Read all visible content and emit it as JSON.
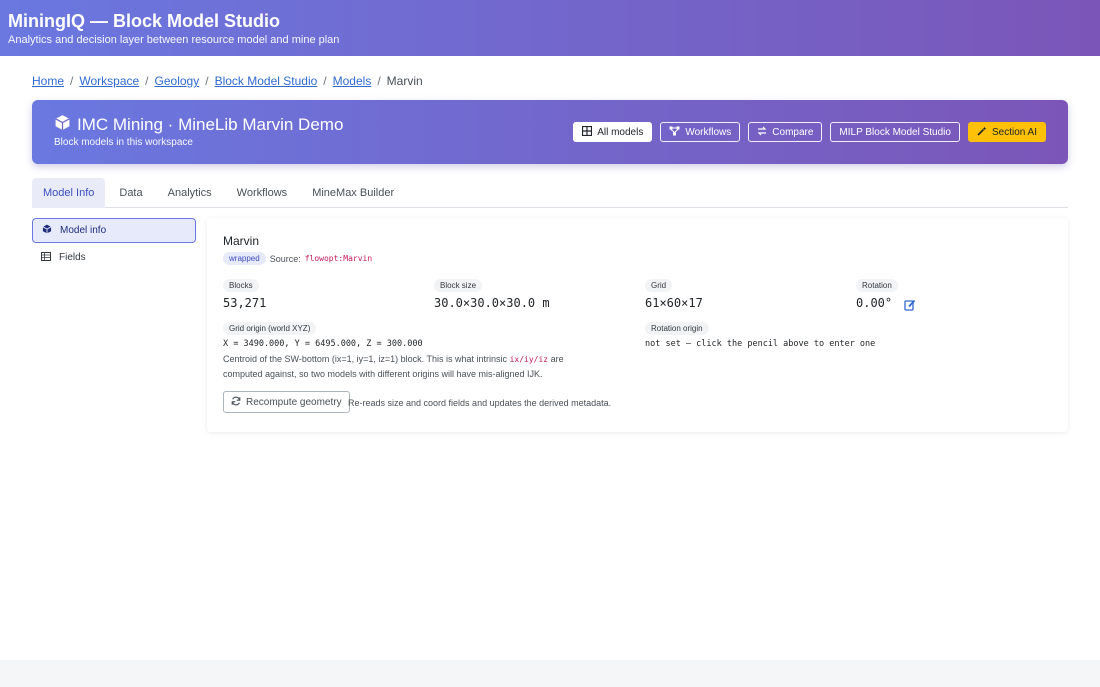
{
  "header": {
    "title": "MiningIQ — Block Model Studio",
    "subtitle": "Analytics and decision layer between resource model and mine plan"
  },
  "breadcrumb": {
    "items": [
      "Home",
      "Workspace",
      "Geology",
      "Block Model Studio",
      "Models"
    ],
    "current": "Marvin"
  },
  "hero": {
    "title": "IMC Mining · MineLib Marvin Demo",
    "subtitle": "Block models in this workspace",
    "actions": {
      "all_models": "All models",
      "workflows": "Workflows",
      "compare": "Compare",
      "milp": "MILP Block Model Studio",
      "section_ai": "Section AI"
    }
  },
  "tabs": [
    "Model Info",
    "Data",
    "Analytics",
    "Workflows",
    "MineMax Builder"
  ],
  "sidenav": {
    "model_info": "Model info",
    "fields": "Fields"
  },
  "card": {
    "model_name": "Marvin",
    "badge": "wrapped",
    "source_label": "Source:",
    "source_value": "flowopt:Marvin",
    "stats": {
      "blocks_label": "Blocks",
      "blocks_value": "53,271",
      "block_size_label": "Block size",
      "block_size_value": "30.0×30.0×30.0 m",
      "grid_label": "Grid",
      "grid_value": "61×60×17",
      "rotation_label": "Rotation",
      "rotation_value": "0.00°"
    },
    "origin": {
      "label": "Grid origin (world XYZ)",
      "value": "X = 3490.000, Y = 6495.000, Z = 300.000",
      "desc_part1": "Centroid of the SW-bottom (ix=1, iy=1, iz=1) block. This is what intrinsic",
      "desc_code": "ix/iy/iz",
      "desc_part2": "are computed against, so two models with different origins will have mis-aligned IJK."
    },
    "rotation_origin": {
      "label": "Rotation origin",
      "value": "not set — click the pencil above to enter one"
    },
    "recompute": {
      "button": "Recompute geometry",
      "note": "Re-reads size and coord fields and updates the derived metadata."
    }
  },
  "colors": {
    "accent": "#6a78e0",
    "accent_end": "#7b56b8",
    "warning": "#ffc107",
    "link": "#2f6ad1",
    "code": "#c2185b"
  }
}
